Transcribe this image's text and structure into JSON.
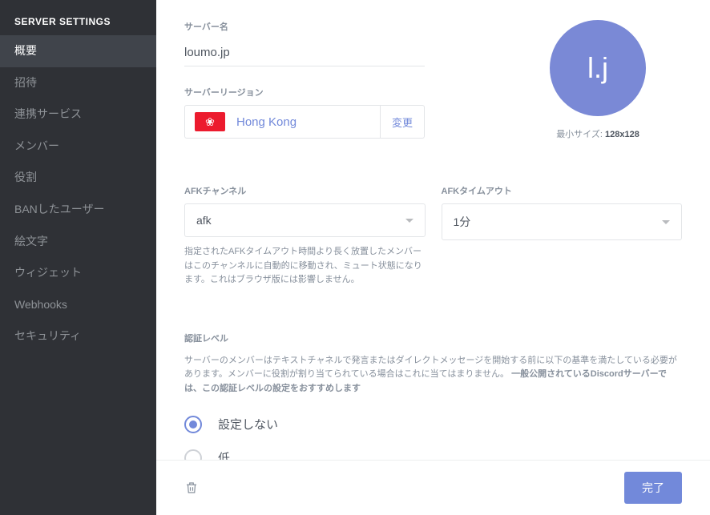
{
  "sidebar": {
    "header": "SERVER SETTINGS",
    "items": [
      {
        "label": "概要",
        "active": true
      },
      {
        "label": "招待",
        "active": false
      },
      {
        "label": "連携サービス",
        "active": false
      },
      {
        "label": "メンバー",
        "active": false
      },
      {
        "label": "役割",
        "active": false
      },
      {
        "label": "BANしたユーザー",
        "active": false
      },
      {
        "label": "絵文字",
        "active": false
      },
      {
        "label": "ウィジェット",
        "active": false
      },
      {
        "label": "Webhooks",
        "active": false
      },
      {
        "label": "セキュリティ",
        "active": false
      }
    ]
  },
  "server_name": {
    "label": "サーバー名",
    "value": "loumo.jp"
  },
  "server_region": {
    "label": "サーバーリージョン",
    "value": "Hong Kong",
    "change_label": "変更"
  },
  "avatar": {
    "initials": "l.j",
    "caption_prefix": "最小サイズ: ",
    "caption_value": "128x128"
  },
  "afk_channel": {
    "label": "AFKチャンネル",
    "value": "afk",
    "help": "指定されたAFKタイムアウト時間より長く放置したメンバーはこのチャンネルに自動的に移動され、ミュート状態になります。これはブラウザ版には影響しません。"
  },
  "afk_timeout": {
    "label": "AFKタイムアウト",
    "value": "1分"
  },
  "verification": {
    "label": "認証レベル",
    "help_a": "サーバーのメンバーはテキストチャネルで発言またはダイレクトメッセージを開始する前に以下の基準を満たしている必要があります。メンバーに役割が割り当てられている場合はこれに当てはまりません。",
    "help_b": "一般公開されているDiscordサーバーでは、この認証レベルの設定をおすすめします",
    "options": [
      {
        "label": "設定しない",
        "selected": true
      },
      {
        "label": "低",
        "selected": false
      }
    ]
  },
  "footer": {
    "done_label": "完了"
  }
}
